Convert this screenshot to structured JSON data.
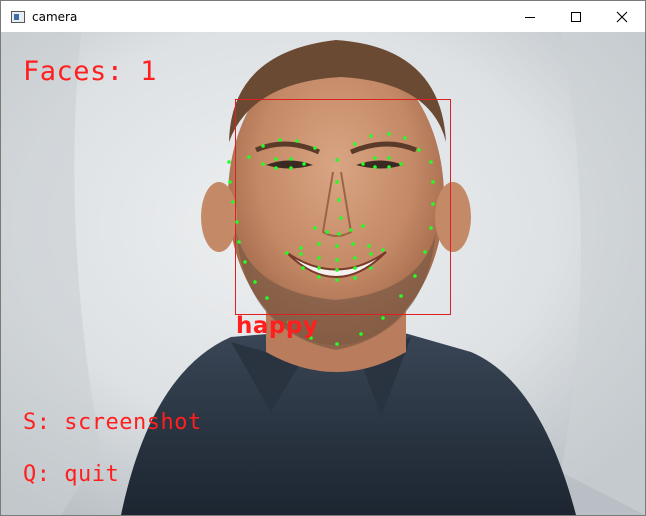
{
  "window": {
    "title": "camera",
    "icon": "app-window-icon"
  },
  "controls": {
    "minimize": "minimize-icon",
    "maximize": "maximize-icon",
    "close": "close-icon"
  },
  "overlay": {
    "faces_label": "Faces: 1",
    "emotion_label": "happy",
    "screenshot_hint": "S: screenshot",
    "quit_hint": "Q: quit",
    "text_color": "#ff1f1f",
    "box_color": "#e02020",
    "landmark_color": "#22ff22"
  }
}
